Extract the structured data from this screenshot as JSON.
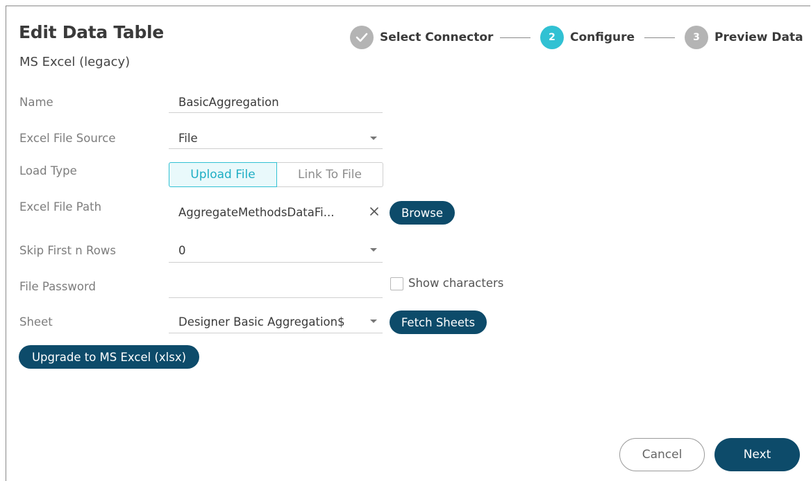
{
  "dialog": {
    "title": "Edit Data Table",
    "subtitle": "MS Excel (legacy)"
  },
  "stepper": {
    "steps": [
      {
        "number": "",
        "label": "Select Connector",
        "state": "completed",
        "icon": "check-icon"
      },
      {
        "number": "2",
        "label": "Configure",
        "state": "active"
      },
      {
        "number": "3",
        "label": "Preview Data",
        "state": "pending"
      }
    ]
  },
  "form": {
    "name": {
      "label": "Name",
      "value": "BasicAggregation"
    },
    "excel_file_source": {
      "label": "Excel File Source",
      "value": "File"
    },
    "load_type": {
      "label": "Load Type",
      "options": [
        "Upload File",
        "Link To File"
      ],
      "selected": "Upload File"
    },
    "excel_file_path": {
      "label": "Excel File Path",
      "value": "AggregateMethodsDataFi...",
      "browse_label": "Browse",
      "clear_icon": "close-icon"
    },
    "skip_first_n_rows": {
      "label": "Skip First n Rows",
      "value": "0"
    },
    "file_password": {
      "label": "File Password",
      "value": "",
      "show_characters_label": "Show characters",
      "show_characters_checked": false
    },
    "sheet": {
      "label": "Sheet",
      "value": "Designer Basic Aggregation$",
      "fetch_label": "Fetch Sheets"
    },
    "upgrade_label": "Upgrade to MS Excel (xlsx)"
  },
  "footer": {
    "cancel_label": "Cancel",
    "next_label": "Next"
  },
  "colors": {
    "primary": "#0d4b6a",
    "accent": "#31c1d3",
    "step_inactive": "#b4b4b4"
  }
}
